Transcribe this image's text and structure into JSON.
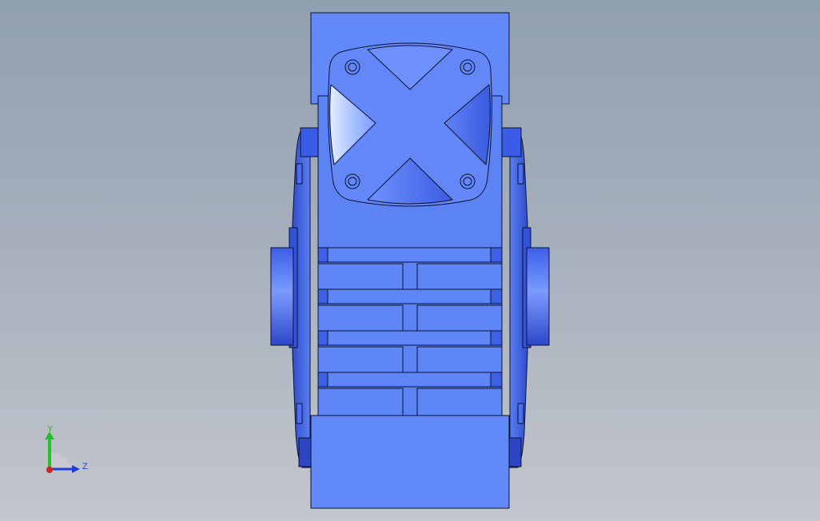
{
  "triad": {
    "y_label": "Y",
    "z_label": "Z",
    "colors": {
      "y": "#22c22a",
      "z": "#1f3fd6",
      "origin": "#d62020"
    }
  },
  "model": {
    "colors": {
      "body": "#5f86f5",
      "body_light": "#7fa2ff",
      "body_dark": "#2f4fd8",
      "shade": "#3557dd",
      "outline": "#0b1230"
    }
  }
}
